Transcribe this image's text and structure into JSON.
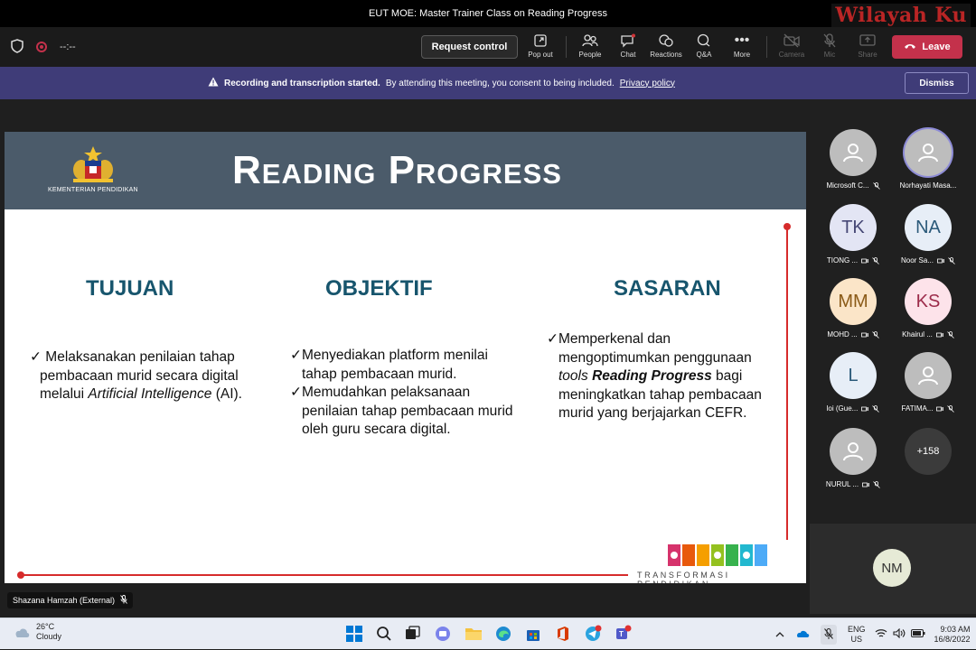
{
  "window": {
    "title": "EUT MOE: Master Trainer Class on Reading Progress",
    "watermark": "Wilayah Ku"
  },
  "toolbar": {
    "timer": "--:--",
    "request_control": "Request control",
    "buttons": {
      "pop_out": "Pop out",
      "people": "People",
      "chat": "Chat",
      "reactions": "Reactions",
      "qa": "Q&A",
      "more": "More",
      "camera": "Camera",
      "mic": "Mic",
      "share": "Share"
    },
    "leave": "Leave",
    "accent_color": "#c4314b"
  },
  "banner": {
    "bold": "Recording and transcription started.",
    "text": "By attending this meeting, you consent to being included.",
    "link": "Privacy policy",
    "dismiss": "Dismiss",
    "color": "#3f3c78"
  },
  "slide": {
    "ministry": "KEMENTERIAN PENDIDIKAN",
    "title": "Reading Progress",
    "tujuan": {
      "title": "TUJUAN",
      "lines": [
        "✓ Melaksanakan penilaian tahap",
        "pembacaan murid secara digital",
        "melalui ",
        "Artificial Intelligence",
        " (AI)."
      ]
    },
    "objektif": {
      "title": "OBJEKTIF",
      "lines": [
        "✓Menyediakan platform menilai",
        "tahap pembacaan murid.",
        "✓Memudahkan pelaksanaan",
        "penilaian tahap pembacaan murid",
        "oleh guru secara digital."
      ]
    },
    "sasaran": {
      "title": "SASARAN",
      "lines": [
        "✓Memperkenal dan",
        "mengoptimumkan penggunaan",
        "tools ",
        "Reading Progress",
        " bagi",
        "meningkatkan tahap pembacaan",
        "murid yang berjajarkan CEFR."
      ]
    },
    "footer": "TRANSFORMASI PENDIDIKAN",
    "title_color": "#17556d",
    "header_color": "#4b5b6a"
  },
  "speaker": "Shazana Hamzah (External)",
  "participants": [
    {
      "initials": "",
      "name": "Microsoft C...",
      "color": "#bdbdbd"
    },
    {
      "initials": "",
      "name": "Norhayati Masa...",
      "color": "#bdbdbd"
    },
    {
      "initials": "TK",
      "name": "TIONG ...",
      "color": "#e3e5f4"
    },
    {
      "initials": "NA",
      "name": "Noor Sa...",
      "color": "#e7eef7"
    },
    {
      "initials": "MM",
      "name": "MOHD ...",
      "color": "#fbe5c8"
    },
    {
      "initials": "KS",
      "name": "Khairul ...",
      "color": "#fde3ea"
    },
    {
      "initials": "L",
      "name": "loi (Gue...",
      "color": "#e7eef7"
    },
    {
      "initials": "",
      "name": "FATIMA...",
      "color": "#bdbdbd"
    },
    {
      "initials": "",
      "name": "NURUL ...",
      "color": "#bdbdbd"
    },
    {
      "initials": "+158",
      "name": "",
      "color": "#3b3b3b"
    }
  ],
  "presenter_initials": "NM",
  "taskbar": {
    "temp": "26°C",
    "weather": "Cloudy",
    "lang1": "ENG",
    "lang2": "US",
    "time": "9:03 AM",
    "date": "16/8/2022"
  }
}
